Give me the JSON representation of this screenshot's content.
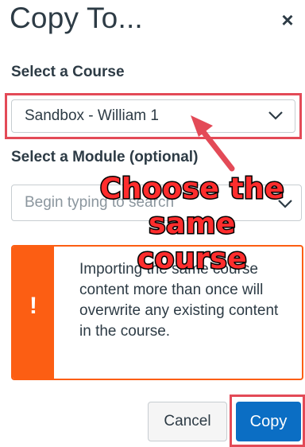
{
  "dialog": {
    "title": "Copy To...",
    "close_symbol": "×"
  },
  "course_field": {
    "label": "Select a Course",
    "selected_value": "Sandbox - William 1"
  },
  "module_field": {
    "label": "Select a Module (optional)",
    "placeholder": "Begin typing to search"
  },
  "alert": {
    "icon": "!",
    "message": "Importing the same course content more than once will overwrite any existing content in the course.",
    "color": "#fc5e13"
  },
  "buttons": {
    "cancel_label": "Cancel",
    "copy_label": "Copy",
    "primary_color": "#0b6ec4"
  },
  "annotation": {
    "text": "Choose the same course",
    "color": "#ff2d2d",
    "highlight_color": "#e34a57"
  },
  "icons": {
    "close": "close-icon",
    "dropdown": "chevron-down-icon",
    "warning": "exclamation-icon",
    "annotation_arrow": "arrow-icon"
  }
}
